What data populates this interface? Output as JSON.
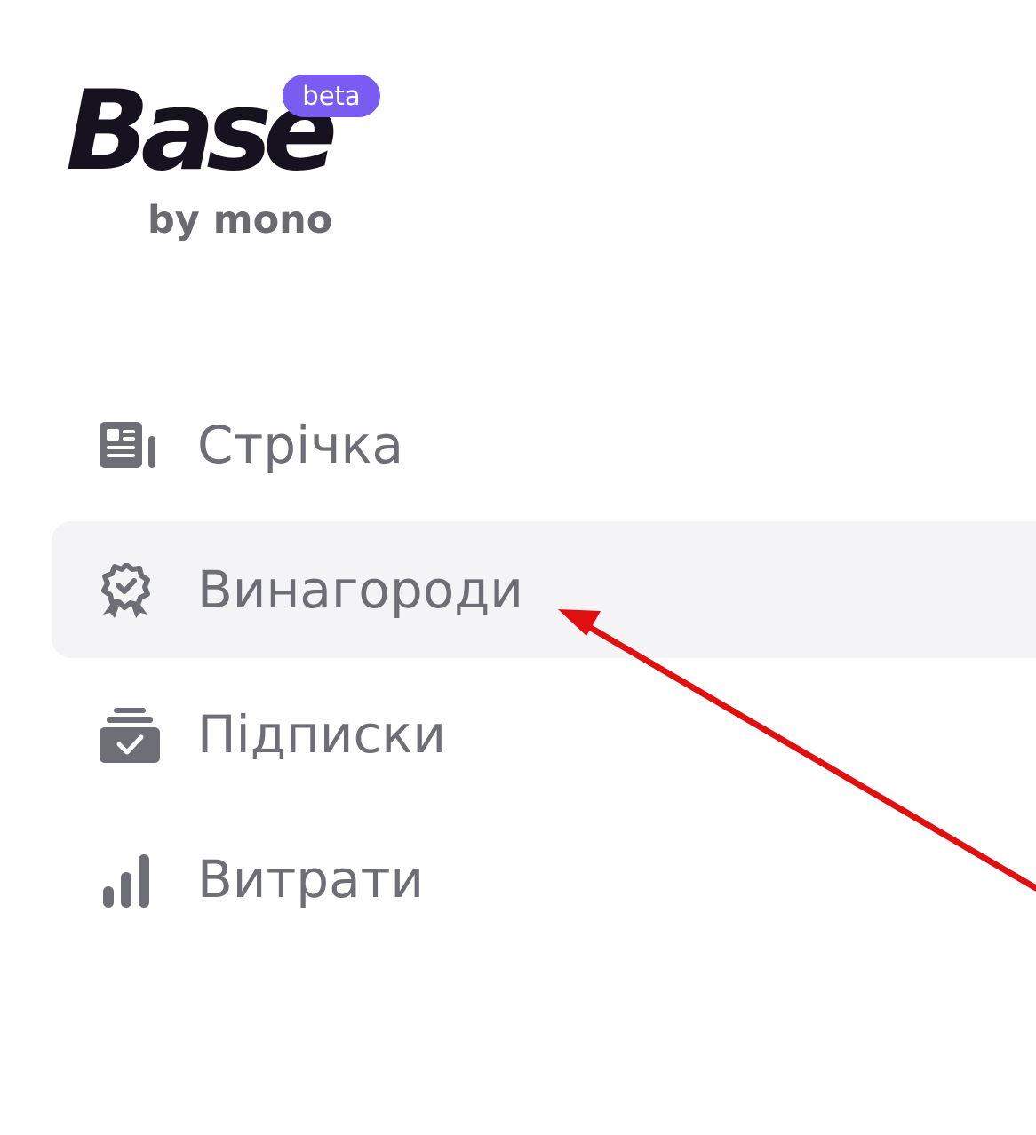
{
  "logo": {
    "wordmark": "Base",
    "badge": "beta",
    "subtitle": "by mono",
    "brand_color": "#16121f",
    "badge_color": "#7a5cf2"
  },
  "nav": {
    "items": [
      {
        "label": "Стрічка",
        "icon": "newspaper-icon",
        "active": false
      },
      {
        "label": "Винагороди",
        "icon": "award-badge-icon",
        "active": true
      },
      {
        "label": "Підписки",
        "icon": "subscriptions-check-icon",
        "active": false
      },
      {
        "label": "Витрати",
        "icon": "bar-chart-icon",
        "active": false
      }
    ],
    "text_color": "#6e6e76",
    "active_background": "#f4f4f6"
  },
  "annotation": {
    "type": "arrow",
    "color": "#e01010",
    "points_to": "Винагороди"
  }
}
